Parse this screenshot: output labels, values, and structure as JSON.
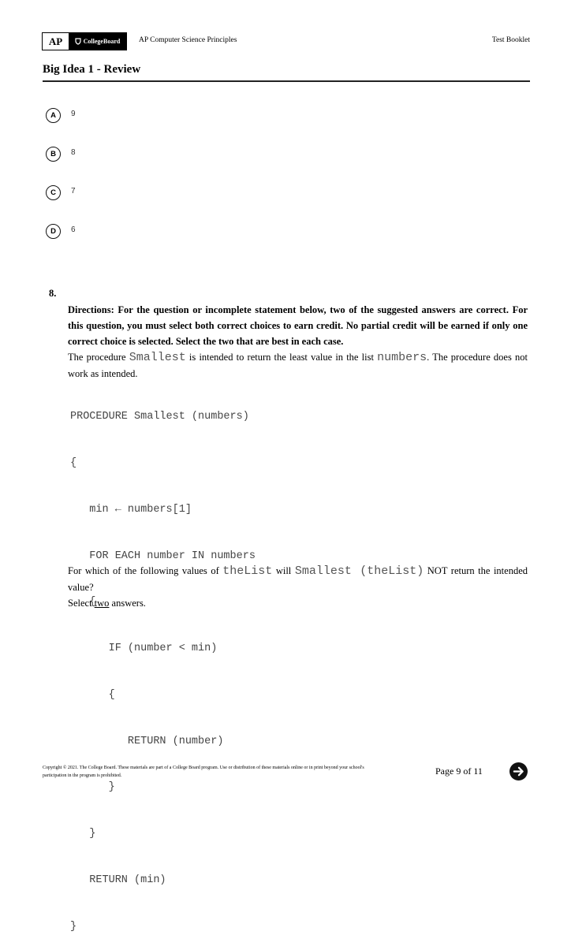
{
  "header": {
    "logo_ap": "AP",
    "logo_collegeboard": "CollegeBoard",
    "course": "AP Computer Science Principles",
    "booklet": "Test Booklet",
    "title": "Big Idea 1 - Review"
  },
  "previous_question": {
    "choices": [
      {
        "letter": "A",
        "text": "9"
      },
      {
        "letter": "B",
        "text": "8"
      },
      {
        "letter": "C",
        "text": "7"
      },
      {
        "letter": "D",
        "text": "6"
      }
    ]
  },
  "question": {
    "number": "8.",
    "directions": "Directions: For the question or incomplete statement below, two of the suggested answers are correct. For this question, you must select both correct choices to earn credit. No partial credit will be earned if only one correct choice is selected. Select the two that are best in each case.",
    "intro_pre": "The procedure ",
    "intro_code1": "Smallest",
    "intro_mid": " is intended to return the least value in the list ",
    "intro_code2": "numbers",
    "intro_post": ". The procedure does not work as intended.",
    "code_lines": [
      "PROCEDURE Smallest (numbers)",
      "{",
      "   min ← numbers[1]",
      "   FOR EACH number IN numbers",
      "   {",
      "      IF (number < min)",
      "      {",
      "         RETURN (number)",
      "      }",
      "   }",
      "   RETURN (min)",
      "}"
    ],
    "prompt_pre": "For which of the following values of ",
    "prompt_code1": "theList",
    "prompt_mid": " will ",
    "prompt_code2": "Smallest (theList)",
    "prompt_post": " NOT return the intended value?",
    "select_pre": "Select ",
    "select_word": "two",
    "select_post": " answers."
  },
  "footer": {
    "copyright": "Copyright © 2021. The College Board. These materials are part of a College Board program. Use or distribution of these materials online or in print beyond your school's participation in the program is prohibited.",
    "page": "Page 9 of 11",
    "next_icon": "arrow-right-circle"
  }
}
